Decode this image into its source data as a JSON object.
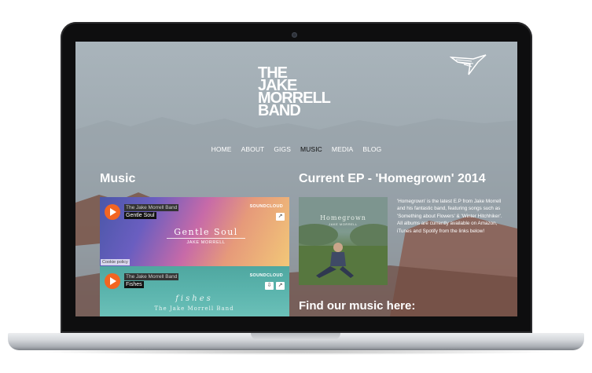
{
  "site": {
    "logo_lines": [
      "THE",
      "JAKE",
      "MORRELL",
      "BAND"
    ]
  },
  "nav": {
    "items": [
      "HOME",
      "ABOUT",
      "GIGS",
      "MUSIC",
      "MEDIA",
      "BLOG"
    ],
    "active": "MUSIC"
  },
  "music": {
    "heading": "Music",
    "players": [
      {
        "artist": "The Jake Morrell Band",
        "track": "Gentle Soul",
        "brand": "SOUNDCLOUD",
        "art_title": "Gentle Soul",
        "art_subtitle": "JAKE MORRELL",
        "cookie_label": "Cookie policy"
      },
      {
        "artist": "The Jake Morrell Band",
        "track": "Fishes",
        "brand": "SOUNDCLOUD",
        "art_title": "fishes",
        "art_subtitle": "The Jake Morrell Band"
      }
    ]
  },
  "ep": {
    "heading": "Current EP - 'Homegrown' 2014",
    "cover_title": "Homegrown",
    "cover_subtitle": "JAKE MORRELL",
    "description": "'Homegrown' is the latest E.P from Jake Morrell and his fantastic band, featuring songs such as 'Something about Flowers' & 'Winter Hitchhiker'.  All albums are currently available on Amazon, iTunes and Spotify from the links below!",
    "find_heading": "Find our music here:"
  },
  "colors": {
    "play_button": "#f26522",
    "laptop_bezel": "#0e0e0f",
    "nav_active": "#111111"
  },
  "icons": {
    "brand": "bird-logo-icon",
    "play": "play-icon",
    "share": "share-icon",
    "download": "download-icon",
    "camera": "camera-icon"
  }
}
